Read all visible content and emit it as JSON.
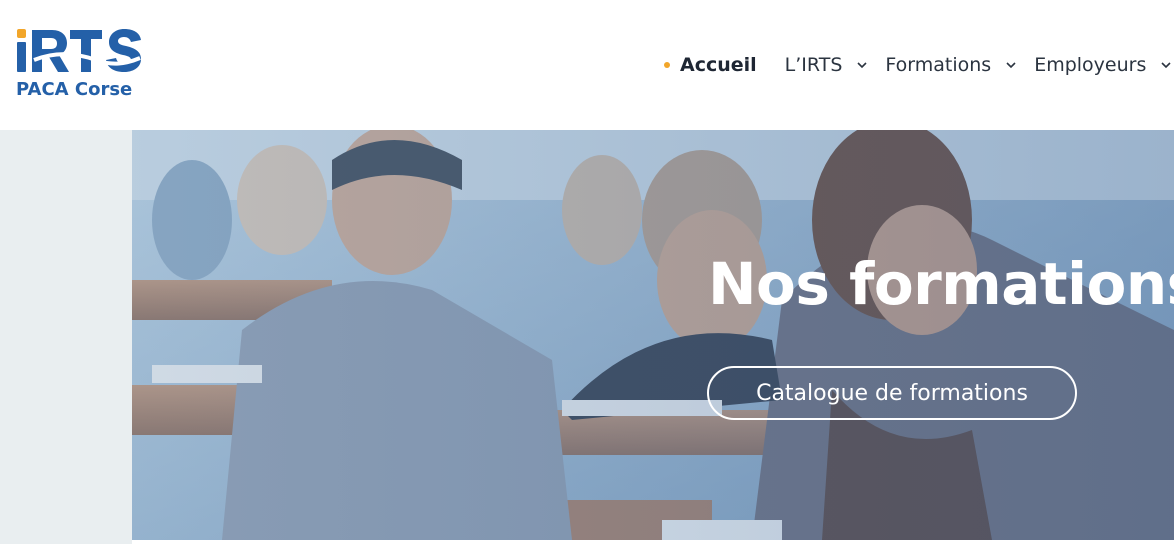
{
  "brand": {
    "logo_text": "iRTS",
    "logo_subtitle": "PACA Corse",
    "colors": {
      "primary": "#2460a8",
      "accent": "#f2a62a"
    }
  },
  "nav": {
    "items": [
      {
        "label": "Accueil",
        "active": true
      },
      {
        "label": "L’IRTS",
        "dropdown": true
      },
      {
        "label": "Formations",
        "dropdown": true
      },
      {
        "label": "Employeurs",
        "dropdown": true
      }
    ]
  },
  "hero": {
    "title": "Nos formations",
    "cta_label": "Catalogue de formations"
  }
}
